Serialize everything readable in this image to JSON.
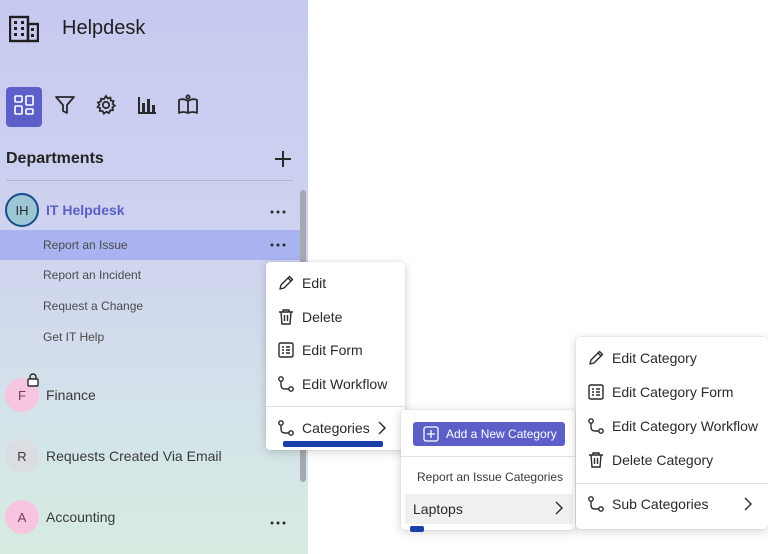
{
  "app": {
    "title": "Helpdesk",
    "logo_icon": "building-icon"
  },
  "toolbar": {
    "buttons": [
      {
        "name": "dashboard-button",
        "icon": "grid-icon",
        "active": true
      },
      {
        "name": "filter-button",
        "icon": "filter-icon",
        "active": false
      },
      {
        "name": "settings-button",
        "icon": "gear-icon",
        "active": false
      },
      {
        "name": "reports-button",
        "icon": "bar-chart-icon",
        "active": false
      },
      {
        "name": "knowledge-button",
        "icon": "book-icon",
        "active": false
      }
    ]
  },
  "departments": {
    "title": "Departments",
    "add_icon": "plus-icon",
    "items": [
      {
        "initials": "IH",
        "name": "IT Helpdesk",
        "active": true,
        "sub_items": [
          {
            "label": "Report an Issue",
            "selected": true
          },
          {
            "label": "Report an Incident",
            "selected": false
          },
          {
            "label": "Request a Change",
            "selected": false
          },
          {
            "label": "Get IT Help",
            "selected": false
          }
        ]
      },
      {
        "initials": "F",
        "name": "Finance",
        "locked": true
      },
      {
        "initials": "R",
        "name": "Requests Created Via Email"
      },
      {
        "initials": "A",
        "name": "Accounting"
      }
    ],
    "more_glyph": "..."
  },
  "context_menu": {
    "items": [
      {
        "label": "Edit",
        "icon": "pencil-icon"
      },
      {
        "label": "Delete",
        "icon": "trash-icon"
      },
      {
        "label": "Edit Form",
        "icon": "form-icon"
      },
      {
        "label": "Edit Workflow",
        "icon": "workflow-icon"
      }
    ],
    "categories": {
      "label": "Categories",
      "icon": "workflow-icon",
      "submenu_icon": "chevron-right-icon"
    }
  },
  "categories_menu": {
    "add_button": "Add a New Category",
    "heading": "Report an Issue Categories",
    "items": [
      {
        "label": "Laptops"
      }
    ]
  },
  "category_menu": {
    "items": [
      {
        "label": "Edit Category",
        "icon": "pencil-icon"
      },
      {
        "label": "Edit Category Form",
        "icon": "form-icon"
      },
      {
        "label": "Edit Category Workflow",
        "icon": "workflow-icon"
      },
      {
        "label": "Delete Category",
        "icon": "trash-icon"
      }
    ],
    "sub_categories": {
      "label": "Sub Categories",
      "icon": "workflow-icon",
      "submenu_icon": "chevron-right-icon"
    }
  },
  "colors": {
    "accent": "#5b5fc7",
    "selected_row": "#a9b3f0",
    "annotation_underline": "#1b3fa8"
  }
}
